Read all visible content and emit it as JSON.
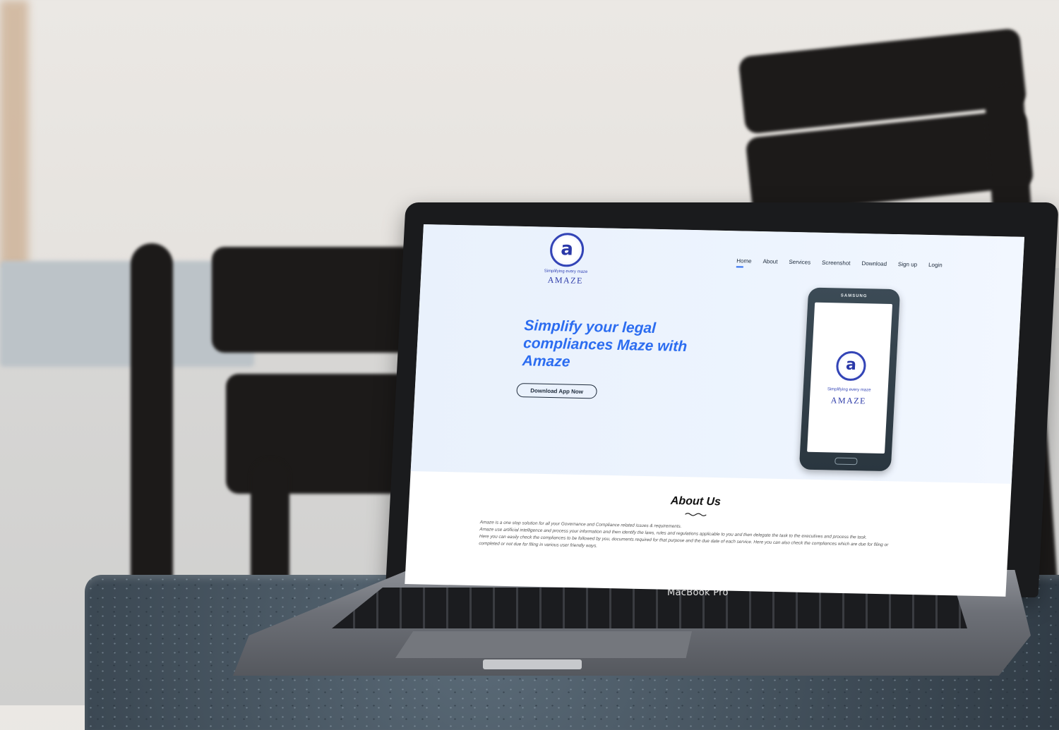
{
  "website": {
    "logo": {
      "letter": "a",
      "tagline": "Simplifying every maze",
      "name": "AMAZE"
    },
    "nav": {
      "items": [
        "Home",
        "About",
        "Services",
        "Screenshot",
        "Download",
        "Sign up",
        "Login"
      ],
      "active": "Home"
    },
    "hero": {
      "headline": "Simplify your legal compliances Maze with Amaze",
      "cta_label": "Download App Now"
    },
    "phone": {
      "brand": "SAMSUNG",
      "logo_letter": "a",
      "tagline": "Simplifying every maze",
      "name": "AMAZE"
    },
    "about": {
      "title": "About Us",
      "paragraphs": [
        "Amaze is a one stop solution for all your Governance and Compliance related issues & requirements.",
        "Amaze use artificial intelligence and process your information and then identify the laws, rules and regulations applicable to you and then delegate the task to the executives and process the task.",
        "Here you can easily check the compliances to be followed by you, documents required for that purpose and the due date of each service. Here you can also check the compliances which are due for filing or completed or not due for filing in various user friendly ways."
      ]
    }
  },
  "device": {
    "label": "MacBook Pro"
  },
  "colors": {
    "accent": "#2b6cf0",
    "logo_blue": "#2a38a8",
    "hero_bg": "#eaf2fd"
  }
}
